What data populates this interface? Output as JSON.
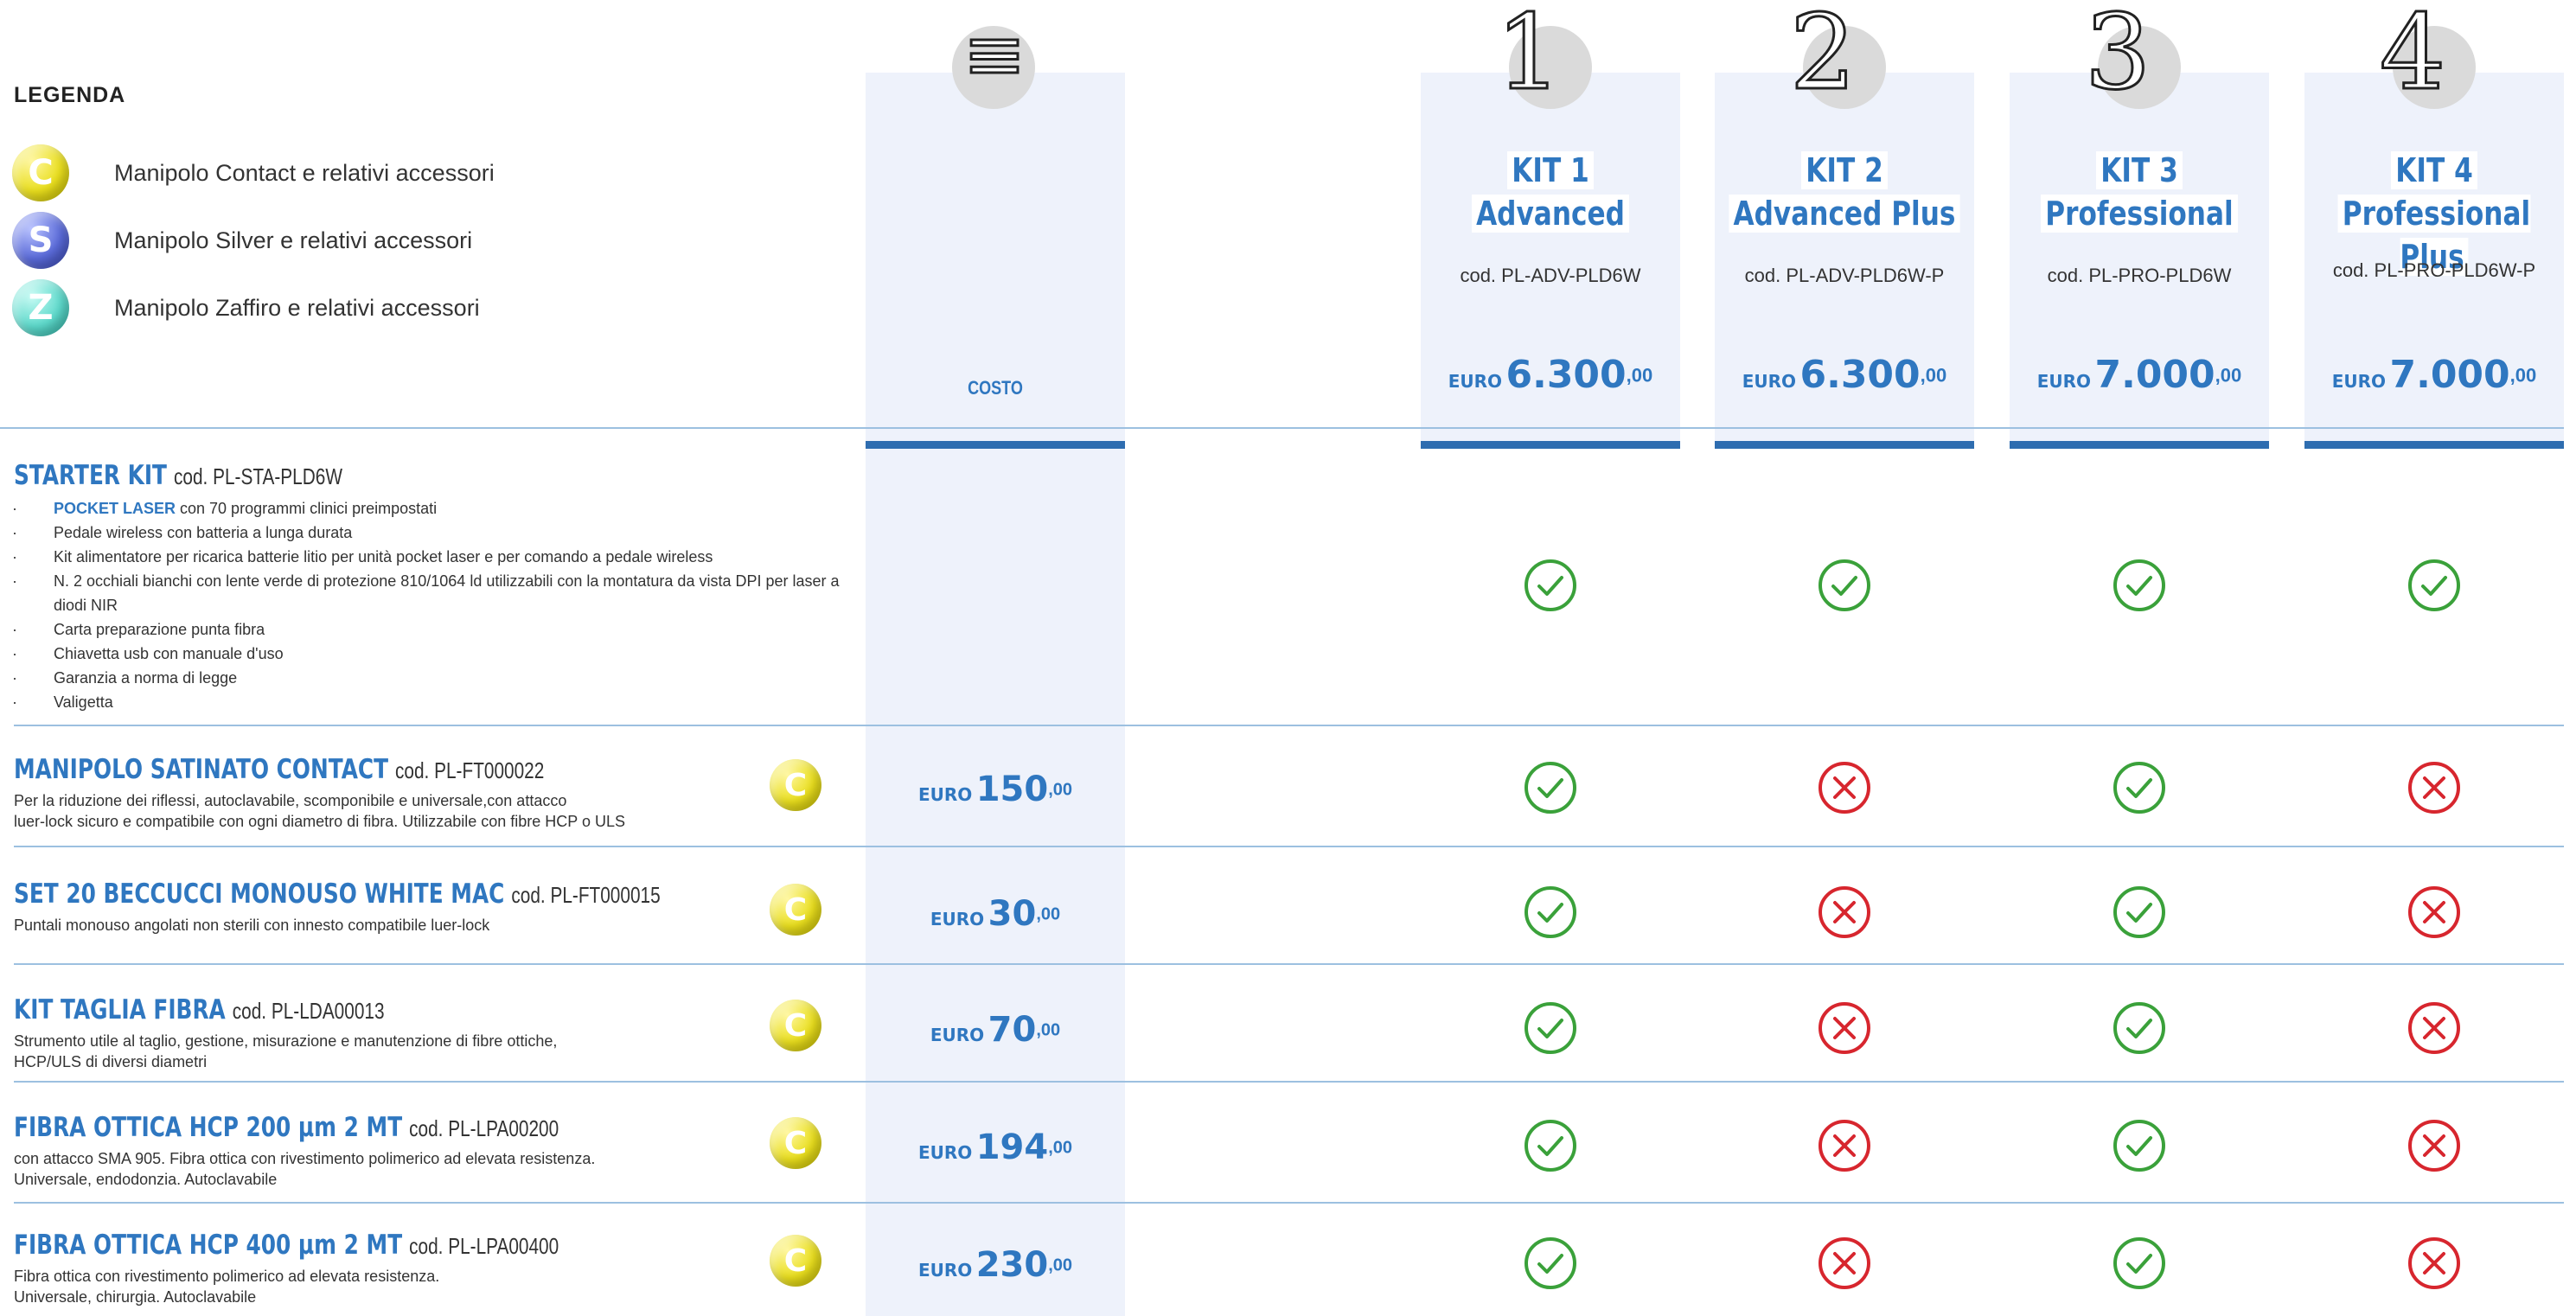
{
  "legend": {
    "title": "LEGENDA",
    "items": [
      {
        "letter": "C",
        "label": "Manipolo Contact e relativi accessori",
        "color": "#e9de1e"
      },
      {
        "letter": "S",
        "label": "Manipolo Silver e relativi accessori",
        "color": "#5a6ad8"
      },
      {
        "letter": "Z",
        "label": "Manipolo Zaffiro e relativi accessori",
        "color": "#5ed9cb"
      }
    ]
  },
  "cost_column": {
    "label": "COSTO"
  },
  "kits": [
    {
      "number": "1",
      "title_line1": "KIT 1",
      "title_line2": "Advanced",
      "code": "cod. PL-ADV-PLD6W",
      "currency": "EURO",
      "amount": "6.300",
      "cents": ",00"
    },
    {
      "number": "2",
      "title_line1": "KIT 2",
      "title_line2": "Advanced Plus",
      "code": "cod. PL-ADV-PLD6W-P",
      "currency": "EURO",
      "amount": "6.300",
      "cents": ",00"
    },
    {
      "number": "3",
      "title_line1": "KIT 3",
      "title_line2": "Professional",
      "code": "cod. PL-PRO-PLD6W",
      "currency": "EURO",
      "amount": "7.000",
      "cents": ",00"
    },
    {
      "number": "4",
      "title_line1": "KIT 4",
      "title_line2": "Professional Plus",
      "code": "cod. PL-PRO-PLD6W-P",
      "currency": "EURO",
      "amount": "7.000",
      "cents": ",00"
    }
  ],
  "starter": {
    "title": "STARTER KIT",
    "code": "cod. PL-STA-PLD6W",
    "bullets": [
      {
        "bold": "POCKET LASER",
        "text": " con 70 programmi clinici preimpostati"
      },
      {
        "bold": "",
        "text": "Pedale wireless con batteria a lunga durata"
      },
      {
        "bold": "",
        "text": "Kit alimentatore per ricarica batterie litio per unità pocket laser e per comando a pedale wireless"
      },
      {
        "bold": "",
        "text": "N. 2 occhiali bianchi con lente verde di protezione 810/1064 ld utilizzabili con la montatura da vista DPI per laser a diodi NIR"
      },
      {
        "bold": "",
        "text": "Carta preparazione punta fibra"
      },
      {
        "bold": "",
        "text": "Chiavetta usb con manuale d'uso"
      },
      {
        "bold": "",
        "text": "Garanzia a norma di legge"
      },
      {
        "bold": "",
        "text": "Valigetta"
      }
    ],
    "included": [
      true,
      true,
      true,
      true
    ]
  },
  "products": [
    {
      "title": "MANIPOLO SATINATO CONTACT",
      "code": "cod. PL-FT000022",
      "desc_line1": "Per la riduzione dei riflessi, autoclavabile, scomponibile e universale,con attacco",
      "desc_line2": "luer-lock sicuro e compatibile con ogni diametro di fibra. Utilizzabile con fibre HCP o ULS",
      "badge": "C",
      "currency": "EURO",
      "amount": "150",
      "cents": ",00",
      "included": [
        true,
        false,
        true,
        false
      ]
    },
    {
      "title": "SET 20 BECCUCCI MONOUSO WHITE MAC",
      "code": "cod. PL-FT000015",
      "desc_line1": "Puntali monouso angolati non sterili con innesto compatibile luer-lock",
      "desc_line2": "",
      "badge": "C",
      "currency": "EURO",
      "amount": "30",
      "cents": ",00",
      "included": [
        true,
        false,
        true,
        false
      ]
    },
    {
      "title": "KIT TAGLIA FIBRA",
      "code": "cod. PL-LDA00013",
      "desc_line1": "Strumento utile al taglio, gestione, misurazione e manutenzione di fibre ottiche,",
      "desc_line2": "HCP/ULS di diversi diametri",
      "badge": "C",
      "currency": "EURO",
      "amount": "70",
      "cents": ",00",
      "included": [
        true,
        false,
        true,
        false
      ]
    },
    {
      "title": "FIBRA OTTICA HCP 200 µm 2 MT",
      "code": "cod. PL-LPA00200",
      "desc_line1": "con attacco SMA 905. Fibra ottica con rivestimento polimerico ad elevata resistenza.",
      "desc_line2": "Universale, endodonzia. Autoclavabile",
      "badge": "C",
      "currency": "EURO",
      "amount": "194",
      "cents": ",00",
      "included": [
        true,
        false,
        true,
        false
      ]
    },
    {
      "title": "FIBRA OTTICA HCP 400 µm 2 MT",
      "code": "cod. PL-LPA00400",
      "desc_line1": "Fibra ottica con rivestimento polimerico ad elevata resistenza.",
      "desc_line2": "Universale, chirurgia. Autoclavabile",
      "badge": "C",
      "currency": "EURO",
      "amount": "230",
      "cents": ",00",
      "included": [
        true,
        false,
        true,
        false
      ]
    }
  ],
  "colors": {
    "accent": "#2f77c0",
    "check": "#3aa13a",
    "cross": "#d7262e",
    "column_bg": "#eef2fb"
  }
}
